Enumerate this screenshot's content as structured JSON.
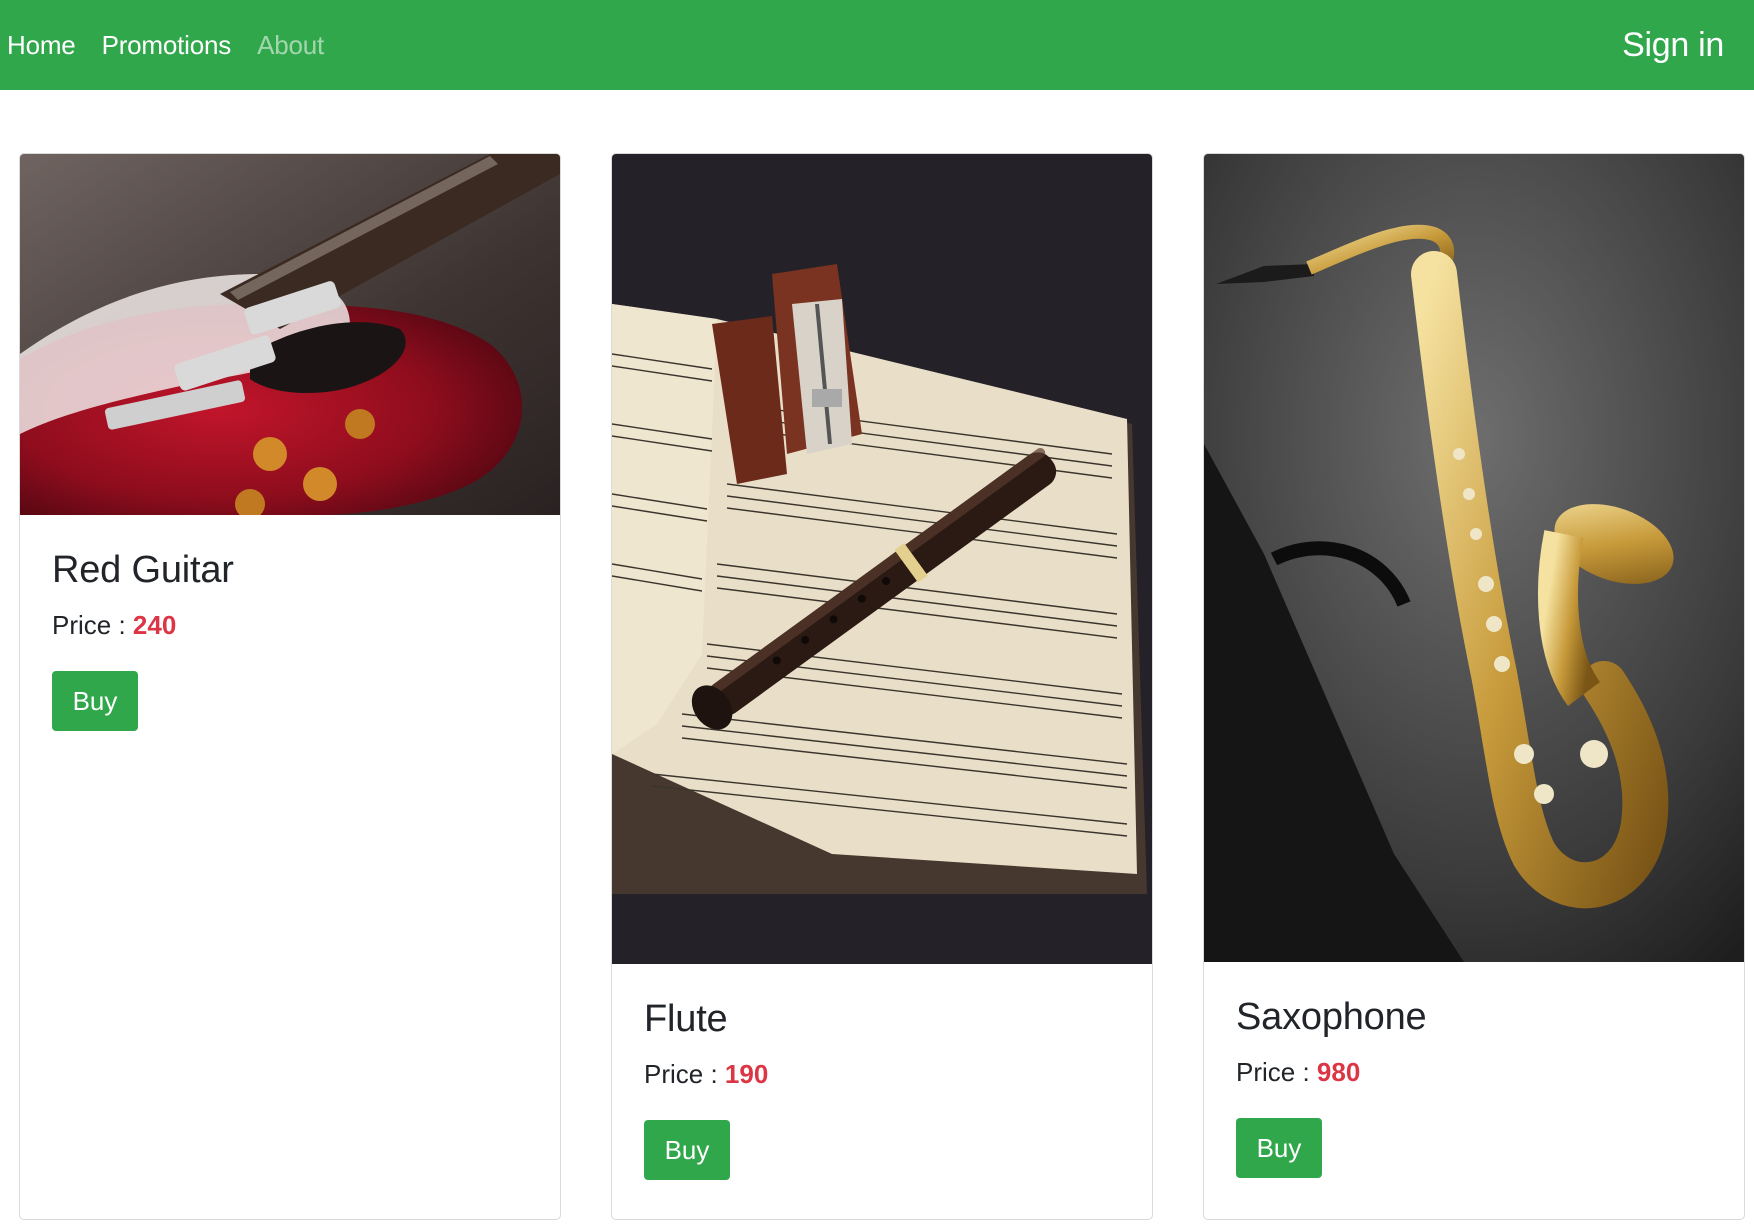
{
  "navbar": {
    "links": [
      {
        "label": "Home"
      },
      {
        "label": "Promotions"
      },
      {
        "label": "About"
      }
    ],
    "sign_in": "Sign in",
    "color": "#31a74c"
  },
  "products": [
    {
      "name": "Red Guitar",
      "price_label": "Price : ",
      "price": "240",
      "buy_label": "Buy",
      "image": "red-electric-guitar-photo"
    },
    {
      "name": "Flute",
      "price_label": "Price : ",
      "price": "190",
      "buy_label": "Buy",
      "image": "recorder-on-sheet-music-photo"
    },
    {
      "name": "Saxophone",
      "price_label": "Price : ",
      "price": "980",
      "buy_label": "Buy",
      "image": "saxophone-in-case-photo"
    }
  ],
  "colors": {
    "primary": "#31a74c",
    "price": "#dc3545"
  }
}
